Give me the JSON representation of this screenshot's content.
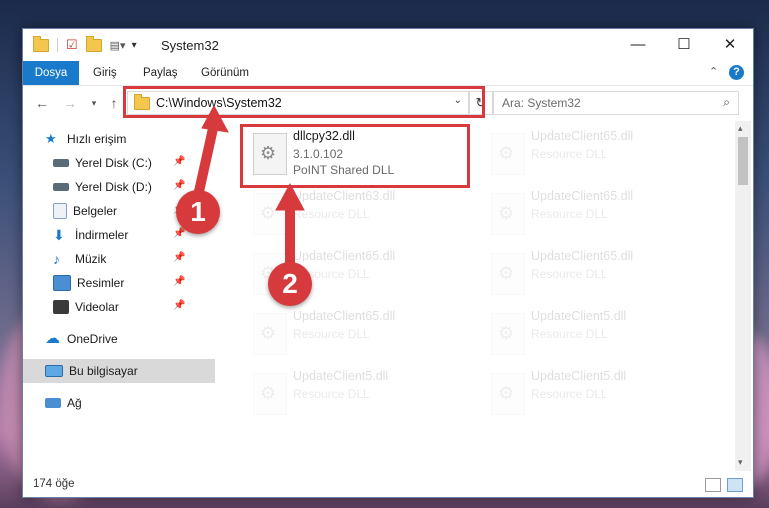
{
  "window": {
    "title": "System32",
    "controls": {
      "minimize": "—",
      "maximize": "☐",
      "close": "✕"
    }
  },
  "ribbon": {
    "tabs": [
      "Dosya",
      "Giriş",
      "Paylaş",
      "Görünüm"
    ],
    "collapse_icon": "chevron-up-icon",
    "help_icon": "help-icon"
  },
  "navigation": {
    "address": "C:\\Windows\\System32",
    "search_placeholder": "Ara: System32"
  },
  "sidebar": {
    "items": [
      {
        "label": "Hızlı erişim",
        "icon": "star-icon",
        "pinned": false
      },
      {
        "label": "Yerel Disk (C:)",
        "icon": "drive-icon",
        "pinned": true
      },
      {
        "label": "Yerel Disk (D:)",
        "icon": "drive-icon",
        "pinned": true
      },
      {
        "label": "Belgeler",
        "icon": "documents-icon",
        "pinned": true
      },
      {
        "label": "İndirmeler",
        "icon": "download-icon",
        "pinned": true
      },
      {
        "label": "Müzik",
        "icon": "music-icon",
        "pinned": true
      },
      {
        "label": "Resimler",
        "icon": "pictures-icon",
        "pinned": true
      },
      {
        "label": "Videolar",
        "icon": "videos-icon",
        "pinned": true
      },
      {
        "label": "OneDrive",
        "icon": "cloud-icon",
        "pinned": false
      },
      {
        "label": "Bu bilgisayar",
        "icon": "computer-icon",
        "pinned": false,
        "selected": true
      },
      {
        "label": "Ağ",
        "icon": "network-icon",
        "pinned": false
      }
    ]
  },
  "files": [
    {
      "name": "dllcpy32.dll",
      "version": "3.1.0.102",
      "description": "PoINT Shared DLL",
      "highlighted": true
    },
    {
      "name": "UpdateClient65.dll",
      "version": "",
      "description": "Resource DLL"
    },
    {
      "name": "UpdateClient63.dll",
      "version": "",
      "description": "Resource DLL"
    },
    {
      "name": "UpdateClient65.dll",
      "version": "",
      "description": "Resource DLL"
    },
    {
      "name": "UpdateClient65.dll",
      "version": "",
      "description": "Resource DLL"
    },
    {
      "name": "UpdateClient65.dll",
      "version": "",
      "description": "Resource DLL"
    },
    {
      "name": "UpdateClient65.dll",
      "version": "",
      "description": "Resource DLL"
    },
    {
      "name": "UpdateClient5.dll",
      "version": "",
      "description": "Resource DLL"
    },
    {
      "name": "UpdateClient5.dll",
      "version": "",
      "description": "Resource DLL"
    },
    {
      "name": "UpdateClient5.dll",
      "version": "",
      "description": "Resource DLL"
    }
  ],
  "status": {
    "item_count": "174 öğe"
  },
  "callouts": [
    "1",
    "2"
  ],
  "colors": {
    "ribbon_file_tab": "#1979ca",
    "callout": "#d63a3c",
    "selection": "#d9d9d9"
  }
}
